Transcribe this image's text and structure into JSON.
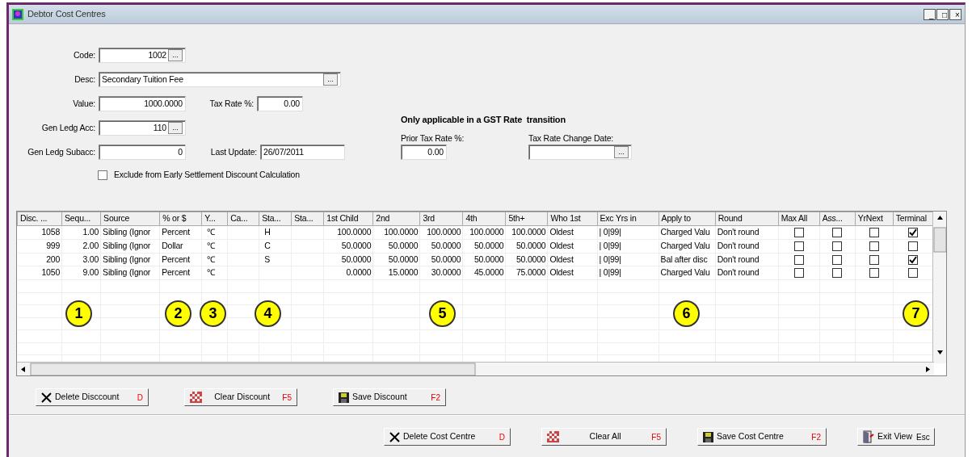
{
  "window": {
    "title": "Debtor Cost Centres",
    "controls": [
      "_",
      "□",
      "×"
    ]
  },
  "form": {
    "fields": [
      {
        "kind": "browse",
        "label": "Code:",
        "value": "1002",
        "button": "..."
      },
      {
        "kind": "browsewide",
        "label": "Desc:",
        "value": "Secondary Tuition Fee",
        "button": "..."
      },
      {
        "kind": "pair",
        "label": "Value:",
        "value": "1000.0000",
        "label2": "Tax Rate %:",
        "value2": "0.00"
      },
      {
        "kind": "browse",
        "label": "Gen Ledg Acc:",
        "value": "110",
        "button": "..."
      },
      {
        "kind": "pairdate",
        "label": "Gen Ledg Subacc:",
        "value": "0",
        "label2": "Last Update:",
        "value2": "26/07/2011"
      }
    ],
    "exclude": {
      "label": "Exclude from Early Settlement Discount Calculation",
      "checked": false
    }
  },
  "gst": {
    "heading": "Only applicable in a GST Rate  transition",
    "prior_label": "Prior Tax Rate %:",
    "prior_value": "0.00",
    "date_label": "Tax Rate Change Date:",
    "date_button": "..."
  },
  "discounts": {
    "columns": [
      "Disc. ...",
      "Sequ...",
      "Source",
      "% or $",
      "Y...",
      "Ca...",
      "Sta...",
      "Sta...",
      "1st Child",
      "2nd",
      "3rd",
      "4th",
      "5th+",
      "Who 1st",
      "Exc Yrs in",
      "Apply to",
      "Round",
      "Max All",
      "Ass...",
      "YrNext",
      "Terminal"
    ],
    "rows": [
      {
        "cells": [
          "1058",
          "1.00",
          "Sibling (Ignor",
          "Percent",
          "℃",
          "",
          "H",
          "",
          "100.0000",
          "100.0000",
          "100.0000",
          "100.0000",
          "100.0000",
          "Oldest",
          "| 0|99|",
          "Charged Valu",
          "Don't round"
        ],
        "checks": [
          false,
          false,
          false,
          true
        ]
      },
      {
        "cells": [
          "999",
          "2.00",
          "Sibling (Ignor",
          "Dollar",
          "℃",
          "",
          "C",
          "",
          "50.0000",
          "50.0000",
          "50.0000",
          "50.0000",
          "50.0000",
          "Oldest",
          "| 0|99|",
          "Charged Valu",
          "Don't round"
        ],
        "checks": [
          false,
          false,
          false,
          false
        ]
      },
      {
        "cells": [
          "200",
          "3.00",
          "Sibling (Ignor",
          "Percent",
          "℃",
          "",
          "S",
          "",
          "50.0000",
          "50.0000",
          "50.0000",
          "50.0000",
          "50.0000",
          "Oldest",
          "| 0|99|",
          "Bal after disc",
          "Don't round"
        ],
        "checks": [
          false,
          false,
          false,
          true
        ]
      },
      {
        "cells": [
          "1050",
          "9.00",
          "Sibling (Ignor",
          "Percent",
          "℃",
          "",
          "",
          "",
          "0.0000",
          "15.0000",
          "30.0000",
          "45.0000",
          "75.0000",
          "Oldest",
          "| 0|99|",
          "Charged Valu",
          "Don't round"
        ],
        "checks": [
          false,
          false,
          false,
          false
        ]
      }
    ],
    "callouts": [
      "1",
      "2",
      "3",
      "4",
      "5",
      "6",
      "7"
    ],
    "buttons": [
      {
        "kind": "delete",
        "label": "Delete Disccount",
        "key": "D"
      },
      {
        "kind": "clear",
        "label": "Clear Discount",
        "key": "F5"
      },
      {
        "kind": "save",
        "label": "Save Discount",
        "key": "F2"
      }
    ]
  },
  "footer_buttons": [
    {
      "kind": "delete",
      "label": "Delete Cost Centre",
      "key": "D"
    },
    {
      "kind": "clear",
      "label": "Clear All",
      "key": "F5"
    },
    {
      "kind": "save",
      "label": "Save Cost Centre",
      "key": "F2"
    },
    {
      "kind": "exit",
      "label": "Exit View",
      "key": "Esc"
    }
  ]
}
